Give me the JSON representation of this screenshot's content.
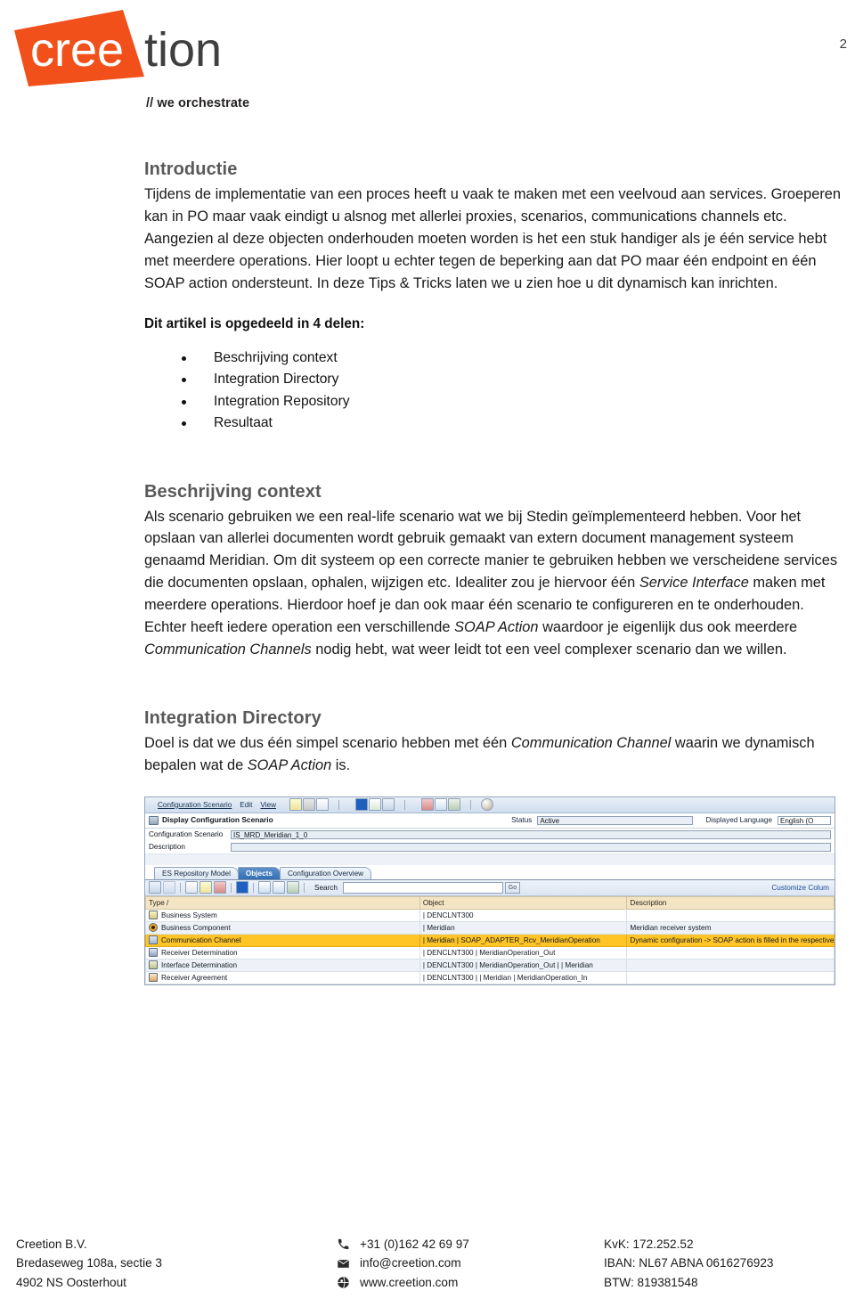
{
  "header": {
    "logo_text_white": "cree",
    "logo_text_dark": "tion",
    "tagline": "// we orchestrate",
    "page_number": "2",
    "brand_orange": "#F1501B",
    "brand_dark": "#3F3F3F"
  },
  "sections": {
    "intro": {
      "heading": "Introductie",
      "paragraph": "Tijdens de implementatie van een proces heeft u vaak te maken met een veelvoud aan services. Groeperen kan in PO maar vaak eindigt u alsnog met allerlei proxies, scenarios, communications channels etc. Aangezien al deze objecten onderhouden moeten worden is het een stuk handiger als je één service hebt met meerdere operations. Hier loopt u echter tegen de beperking aan dat PO maar één endpoint en één SOAP action ondersteunt. In deze Tips & Tricks laten we u zien hoe u dit dynamisch kan inrichten.",
      "lead": "Dit artikel is opgedeeld in 4 delen:",
      "parts": [
        "Beschrijving context",
        "Integration Directory",
        "Integration Repository",
        "Resultaat"
      ]
    },
    "context": {
      "heading": "Beschrijving context",
      "paragraph_parts": [
        {
          "text": "Als scenario gebruiken we een real-life scenario wat we bij Stedin geïmplementeerd hebben. Voor het opslaan van allerlei documenten wordt gebruik gemaakt van extern document management systeem genaamd Meridian. Om dit systeem op een correcte manier te gebruiken hebben we verscheidene services die documenten opslaan, ophalen, wijzigen etc. Idealiter zou je hiervoor één ",
          "italic": false
        },
        {
          "text": "Service Interface",
          "italic": true
        },
        {
          "text": " maken met meerdere operations. Hierdoor hoef je dan ook maar één scenario te configureren en te onderhouden. Echter heeft iedere operation een verschillende ",
          "italic": false
        },
        {
          "text": "SOAP Action",
          "italic": true
        },
        {
          "text": " waardoor je eigenlijk dus ook meerdere ",
          "italic": false
        },
        {
          "text": "Communication Channels",
          "italic": true
        },
        {
          "text": " nodig hebt, wat weer leidt tot een veel complexer scenario dan we willen.",
          "italic": false
        }
      ]
    },
    "directory": {
      "heading": "Integration Directory",
      "paragraph_parts": [
        {
          "text": "Doel is dat we dus één simpel scenario hebben met één ",
          "italic": false
        },
        {
          "text": "Communication Channel",
          "italic": true
        },
        {
          "text": " waarin we dynamisch bepalen wat de ",
          "italic": false
        },
        {
          "text": "SOAP Action",
          "italic": true
        },
        {
          "text": " is.",
          "italic": false
        }
      ]
    }
  },
  "sap_screenshot": {
    "menubar": {
      "items": [
        "Configuration Scenario",
        "Edit",
        "View"
      ],
      "toolbar_icons": [
        "edit-pencil-icon",
        "save-icon",
        "copy-icon",
        "blue-info-icon",
        "network-icon",
        "transport-icon",
        "print-icon",
        "window-icon",
        "display-icon",
        "sphere-icon"
      ]
    },
    "title_row": {
      "icon": "screen-icon",
      "title": "Display Configuration Scenario",
      "status_label": "Status",
      "status_value": "Active",
      "language_label": "Displayed Language",
      "language_value": "English (O"
    },
    "form": {
      "scenario_label": "Configuration Scenario",
      "scenario_value": "IS_MRD_Meridian_1_0",
      "description_label": "Description",
      "description_value": ""
    },
    "tabs": [
      {
        "label": "ES Repository Model",
        "active": false
      },
      {
        "label": "Objects",
        "active": true
      },
      {
        "label": "Configuration Overview",
        "active": false
      }
    ],
    "toolbar2": {
      "search_label": "Search",
      "search_value": "",
      "go_label": "Go",
      "customize_columns": "Customize Colum"
    },
    "table": {
      "columns": [
        "Type",
        "Object",
        "Description"
      ],
      "sort_indicator": "/",
      "rows": [
        {
          "icon": "business-system-icon",
          "type": "Business System",
          "object": "| DENCLNT300",
          "description": "",
          "selected": false
        },
        {
          "icon": "business-component-icon",
          "type": "Business Component",
          "object": "| Meridian",
          "description": "Meridian receiver system",
          "selected": false
        },
        {
          "icon": "communication-channel-icon",
          "type": "Communication Channel",
          "object": "| Meridian | SOAP_ADAPTER_Rcv_MeridianOperation",
          "description": "Dynamic configuration -> SOAP action is filled in the respective messa",
          "selected": true
        },
        {
          "icon": "receiver-determination-icon",
          "type": "Receiver Determination",
          "object": "| DENCLNT300 | MeridianOperation_Out",
          "description": "",
          "selected": false
        },
        {
          "icon": "interface-determination-icon",
          "type": "Interface Determination",
          "object": "| DENCLNT300 | MeridianOperation_Out |  | Meridian",
          "description": "",
          "selected": false
        },
        {
          "icon": "receiver-agreement-icon",
          "type": "Receiver Agreement",
          "object": "| DENCLNT300 |  | Meridian | MeridianOperation_In",
          "description": "",
          "selected": false
        }
      ]
    }
  },
  "footer": {
    "address": [
      "Creetion B.V.",
      "Bredaseweg 108a, sectie 3",
      "4902 NS Oosterhout"
    ],
    "contact": [
      {
        "icon": "phone-icon",
        "text": "+31 (0)162 42 69 97"
      },
      {
        "icon": "envelope-icon",
        "text": "info@creetion.com"
      },
      {
        "icon": "globe-icon",
        "text": "www.creetion.com"
      }
    ],
    "legal": [
      "KvK: 172.252.52",
      "IBAN: NL67 ABNA 0616276923",
      "BTW: 819381548"
    ]
  }
}
